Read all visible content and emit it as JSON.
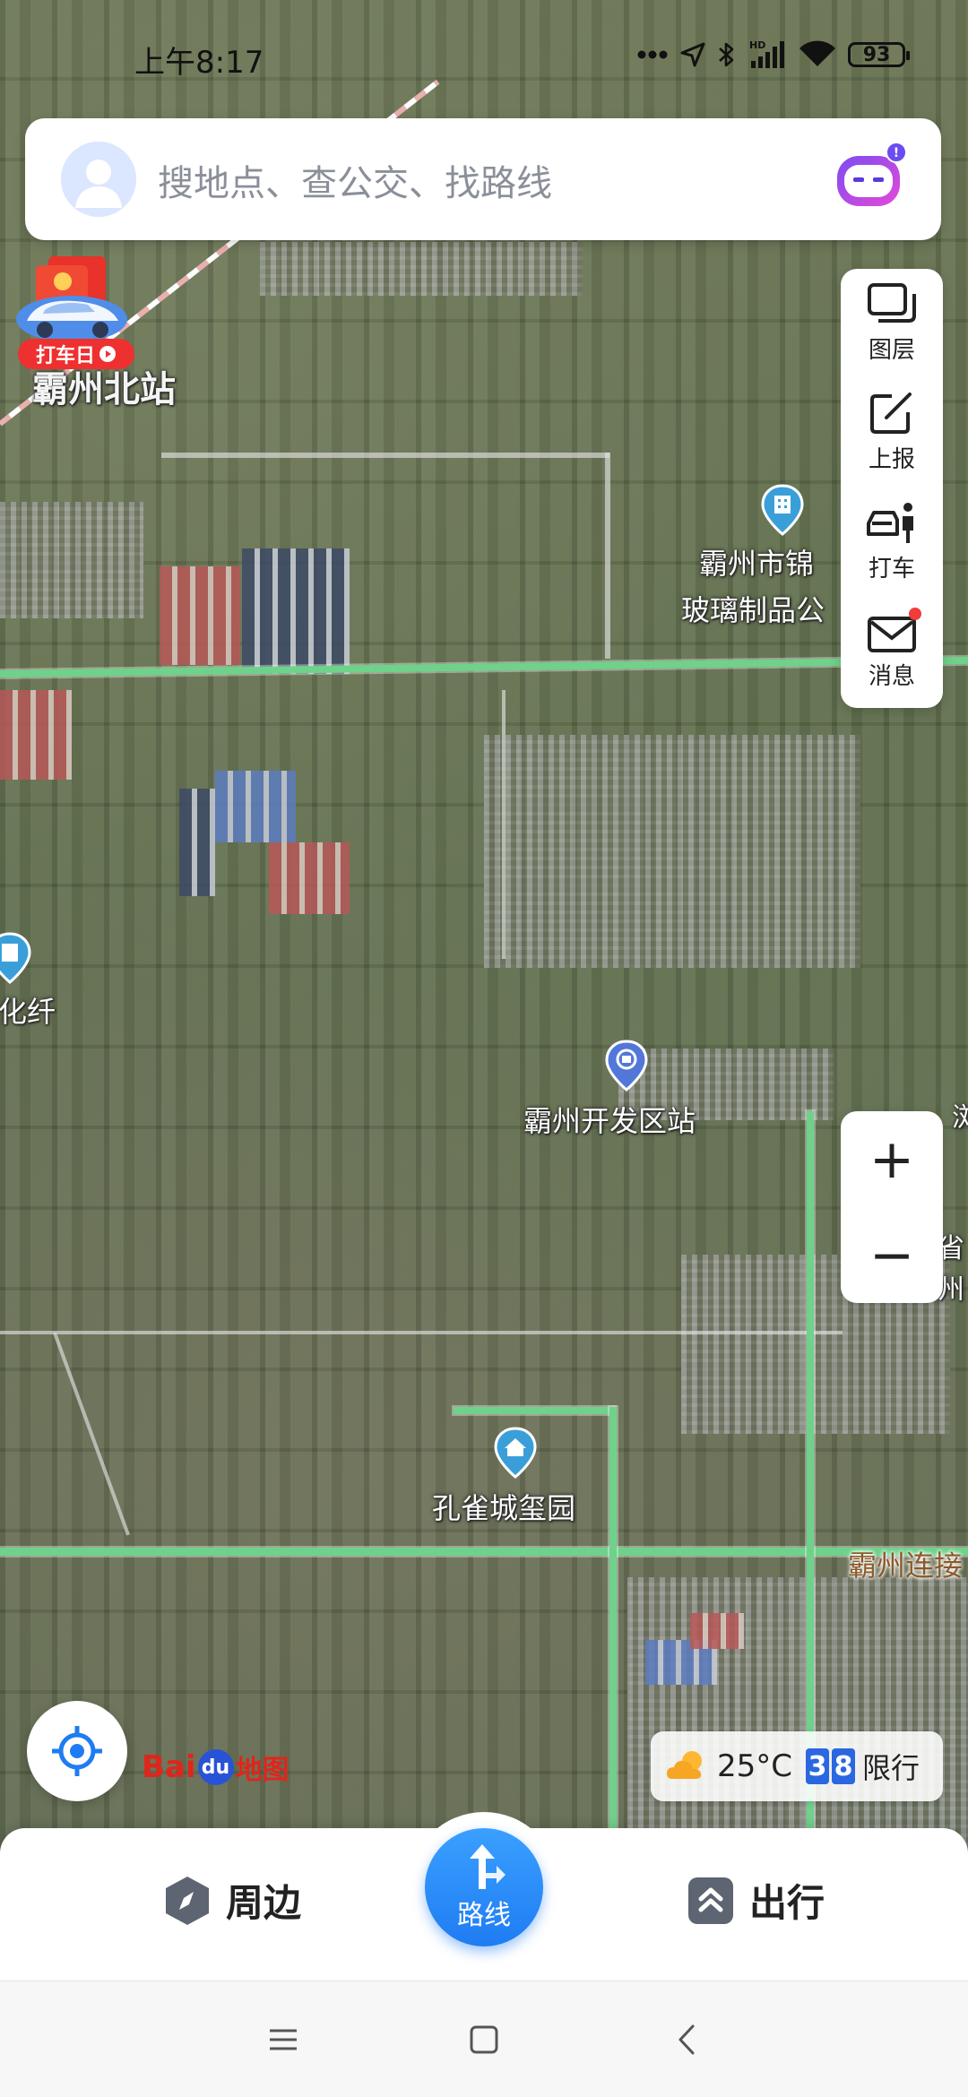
{
  "status_bar": {
    "time": "上午8:17",
    "battery": "93",
    "icons": [
      "more-dots-icon",
      "location-arrow-icon",
      "bluetooth-icon",
      "signal-hd-icon",
      "wifi-icon",
      "battery-icon"
    ]
  },
  "search": {
    "placeholder": "搜地点、查公交、找路线",
    "assistant_badge": "!"
  },
  "promo": {
    "label": "打车日"
  },
  "tools": [
    {
      "label": "图层",
      "icon": "layers-icon"
    },
    {
      "label": "上报",
      "icon": "report-edit-icon"
    },
    {
      "label": "打车",
      "icon": "taxi-person-icon"
    },
    {
      "label": "消息",
      "icon": "mail-icon"
    }
  ],
  "map_labels": {
    "station_north": "霸州北站",
    "company_line1": "霸州市锦",
    "company_line2": "玻璃制品公",
    "fiber": "化纤",
    "dev_zone_station": "霸州开发区站",
    "residence": "孔雀城玺园",
    "road": "霸州连接",
    "edge1": "浏",
    "edge2": "省",
    "edge3": "州"
  },
  "zoom": {
    "in": "+",
    "out": "−"
  },
  "logo": {
    "bai": "Bai",
    "du": "du",
    "ditu": "地图"
  },
  "weather": {
    "temperature": "25°C",
    "limit_digits": [
      "3",
      "8"
    ],
    "limit_label": "限行"
  },
  "bottom": {
    "nearby": "周边",
    "route": "路线",
    "travel": "出行"
  },
  "colors": {
    "accent_blue": "#1f7cf3",
    "road_green": "#6fd28a",
    "alert_red": "#f23b3b"
  }
}
